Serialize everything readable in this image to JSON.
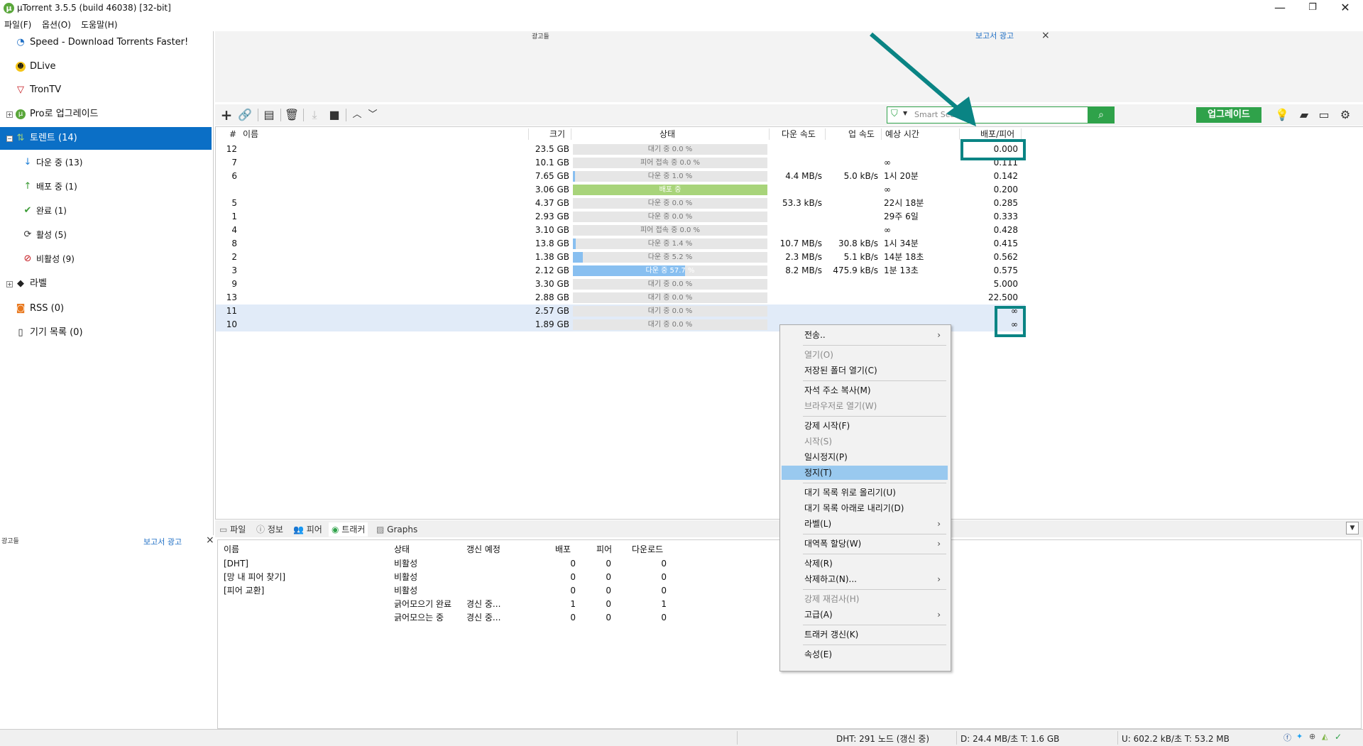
{
  "app": {
    "title": "µTorrent 3.5.5  (build 46038) [32-bit]",
    "window_controls": {
      "minimize": "—",
      "maximize": "❐",
      "close": "✕"
    }
  },
  "menu": [
    "파일(F)",
    "옵션(O)",
    "도움말(H)"
  ],
  "sidebar": {
    "items": [
      {
        "label": "Speed - Download Torrents Faster!",
        "icon": "speedometer-icon"
      },
      {
        "label": "DLive",
        "icon": "dlive-icon"
      },
      {
        "label": "TronTV",
        "icon": "tron-icon"
      },
      {
        "label": "Pro로 업그레이드",
        "icon": "utorrent-icon"
      },
      {
        "label": "토렌트 (14)",
        "icon": "torrent-icon",
        "selected": true
      },
      {
        "label": "다운 중 (13)",
        "icon": "arrow-down-icon"
      },
      {
        "label": "배포 중 (1)",
        "icon": "arrow-up-icon"
      },
      {
        "label": "완료 (1)",
        "icon": "check-icon"
      },
      {
        "label": "활성 (5)",
        "icon": "refresh-icon"
      },
      {
        "label": "비활성 (9)",
        "icon": "inactive-icon"
      },
      {
        "label": "라벨",
        "icon": "tag-icon"
      },
      {
        "label": "RSS (0)",
        "icon": "rss-icon"
      },
      {
        "label": "기기 목록 (0)",
        "icon": "device-icon"
      }
    ]
  },
  "ads": {
    "top_label": "광고들",
    "top_report": "보고서 광고",
    "left_label": "광고들",
    "left_report": "보고서 광고",
    "close": "×"
  },
  "toolbar": {
    "search_placeholder": "Smart Search",
    "upgrade": "업그레이드"
  },
  "torrent_list": {
    "columns": [
      "#",
      "이름",
      "크기",
      "상태",
      "다운 속도",
      "업 속도",
      "예상 시간",
      "배포/피어"
    ],
    "rows": [
      {
        "num": "12",
        "size": "23.5 GB",
        "status": "대기 중 0.0 %",
        "progress": 0,
        "down": "",
        "up": "",
        "eta": "",
        "ratio": "0.000"
      },
      {
        "num": "7",
        "size": "10.1 GB",
        "status": "피어 접속 중 0.0 %",
        "progress": 0,
        "down": "",
        "up": "",
        "eta": "∞",
        "ratio": "0.111"
      },
      {
        "num": "6",
        "size": "7.65 GB",
        "status": "다운 중 1.0 %",
        "progress": 1.0,
        "down": "4.4 MB/s",
        "up": "5.0 kB/s",
        "eta": "1시 20분",
        "ratio": "0.142"
      },
      {
        "num": "",
        "size": "3.06 GB",
        "status": "배포 중",
        "progress": 100,
        "seeding": true,
        "down": "",
        "up": "",
        "eta": "∞",
        "ratio": "0.200"
      },
      {
        "num": "5",
        "size": "4.37 GB",
        "status": "다운 중 0.0 %",
        "progress": 0,
        "down": "53.3 kB/s",
        "up": "",
        "eta": "22시 18분",
        "ratio": "0.285"
      },
      {
        "num": "1",
        "size": "2.93 GB",
        "status": "다운 중 0.0 %",
        "progress": 0,
        "down": "",
        "up": "",
        "eta": "29주 6일",
        "ratio": "0.333"
      },
      {
        "num": "4",
        "size": "3.10 GB",
        "status": "피어 접속 중 0.0 %",
        "progress": 0,
        "down": "",
        "up": "",
        "eta": "∞",
        "ratio": "0.428"
      },
      {
        "num": "8",
        "size": "13.8 GB",
        "status": "다운 중 1.4 %",
        "progress": 1.4,
        "down": "10.7 MB/s",
        "up": "30.8 kB/s",
        "eta": "1시 34분",
        "ratio": "0.415"
      },
      {
        "num": "2",
        "size": "1.38 GB",
        "status": "다운 중 5.2 %",
        "progress": 5.2,
        "down": "2.3 MB/s",
        "up": "5.1 kB/s",
        "eta": "14분 18초",
        "ratio": "0.562"
      },
      {
        "num": "3",
        "size": "2.12 GB",
        "status": "다운 중 57.7 %",
        "progress": 57.7,
        "down": "8.2 MB/s",
        "up": "475.9 kB/s",
        "eta": "1분 13초",
        "ratio": "0.575"
      },
      {
        "num": "9",
        "size": "3.30 GB",
        "status": "대기 중 0.0 %",
        "progress": 0,
        "down": "",
        "up": "",
        "eta": "",
        "ratio": "5.000"
      },
      {
        "num": "13",
        "size": "2.88 GB",
        "status": "대기 중 0.0 %",
        "progress": 0,
        "down": "",
        "up": "",
        "eta": "",
        "ratio": "22.500"
      },
      {
        "num": "11",
        "size": "2.57 GB",
        "status": "대기 중 0.0 %",
        "progress": 0,
        "down": "",
        "up": "",
        "eta": "",
        "ratio": "∞",
        "selected": true
      },
      {
        "num": "10",
        "size": "1.89 GB",
        "status": "대기 중 0.0 %",
        "progress": 0,
        "down": "",
        "up": "",
        "eta": "",
        "ratio": "∞",
        "selected": true
      }
    ]
  },
  "bottom_tabs": [
    "파일",
    "정보",
    "피어",
    "트래커",
    "Graphs"
  ],
  "trackers": {
    "columns": [
      "이름",
      "상태",
      "갱신 예정",
      "배포",
      "피어",
      "다운로드"
    ],
    "rows": [
      {
        "name": "[DHT]",
        "status": "비활성",
        "update": "",
        "seeds": "0",
        "peers": "0",
        "downloaded": "0"
      },
      {
        "name": "[망 내 피어 찾기]",
        "status": "비활성",
        "update": "",
        "seeds": "0",
        "peers": "0",
        "downloaded": "0"
      },
      {
        "name": "[피어 교환]",
        "status": "비활성",
        "update": "",
        "seeds": "0",
        "peers": "0",
        "downloaded": "0"
      },
      {
        "name": "",
        "status": "긁어모으기 완료",
        "update": "경신 중...",
        "seeds": "1",
        "peers": "0",
        "downloaded": "1"
      },
      {
        "name": "",
        "status": "긁어모으는 중",
        "update": "경신 중...",
        "seeds": "0",
        "peers": "0",
        "downloaded": "0"
      }
    ]
  },
  "context_menu": {
    "items": [
      {
        "label": "전송..",
        "submenu": true
      },
      {
        "sep": true
      },
      {
        "label": "열기(O)",
        "disabled": true
      },
      {
        "label": "저장된 폴더 열기(C)"
      },
      {
        "sep": true
      },
      {
        "label": "자석 주소 복사(M)"
      },
      {
        "label": "브라우저로 열기(W)",
        "disabled": true
      },
      {
        "sep": true
      },
      {
        "label": "강제 시작(F)"
      },
      {
        "label": "시작(S)",
        "disabled": true
      },
      {
        "label": "일시정지(P)"
      },
      {
        "label": "정지(T)",
        "highlighted": true
      },
      {
        "sep": true
      },
      {
        "label": "대기 목록 위로 올리기(U)"
      },
      {
        "label": "대기 목록 아래로 내리기(D)"
      },
      {
        "label": "라벨(L)",
        "submenu": true
      },
      {
        "sep": true
      },
      {
        "label": "대역폭 할당(W)",
        "submenu": true
      },
      {
        "sep": true
      },
      {
        "label": "삭제(R)"
      },
      {
        "label": "삭제하고(N)...",
        "submenu": true
      },
      {
        "sep": true
      },
      {
        "label": "강제 재검사(H)",
        "disabled": true
      },
      {
        "label": "고급(A)",
        "submenu": true
      },
      {
        "sep": true
      },
      {
        "label": "트래커 갱신(K)"
      },
      {
        "sep": true
      },
      {
        "label": "속성(E)"
      }
    ]
  },
  "statusbar": {
    "dht": "DHT: 291 노드  (갱신 중)",
    "down": "D: 24.4 MB/초 T: 1.6 GB",
    "up": "U: 602.2 kB/초 T: 53.2 MB"
  },
  "colors": {
    "accent_green": "#2fa24a",
    "selection_blue": "#0b6fc6",
    "annotation_teal": "#0a8484",
    "progress_blue": "#88bff0",
    "seeding_green": "#a8d47a"
  }
}
